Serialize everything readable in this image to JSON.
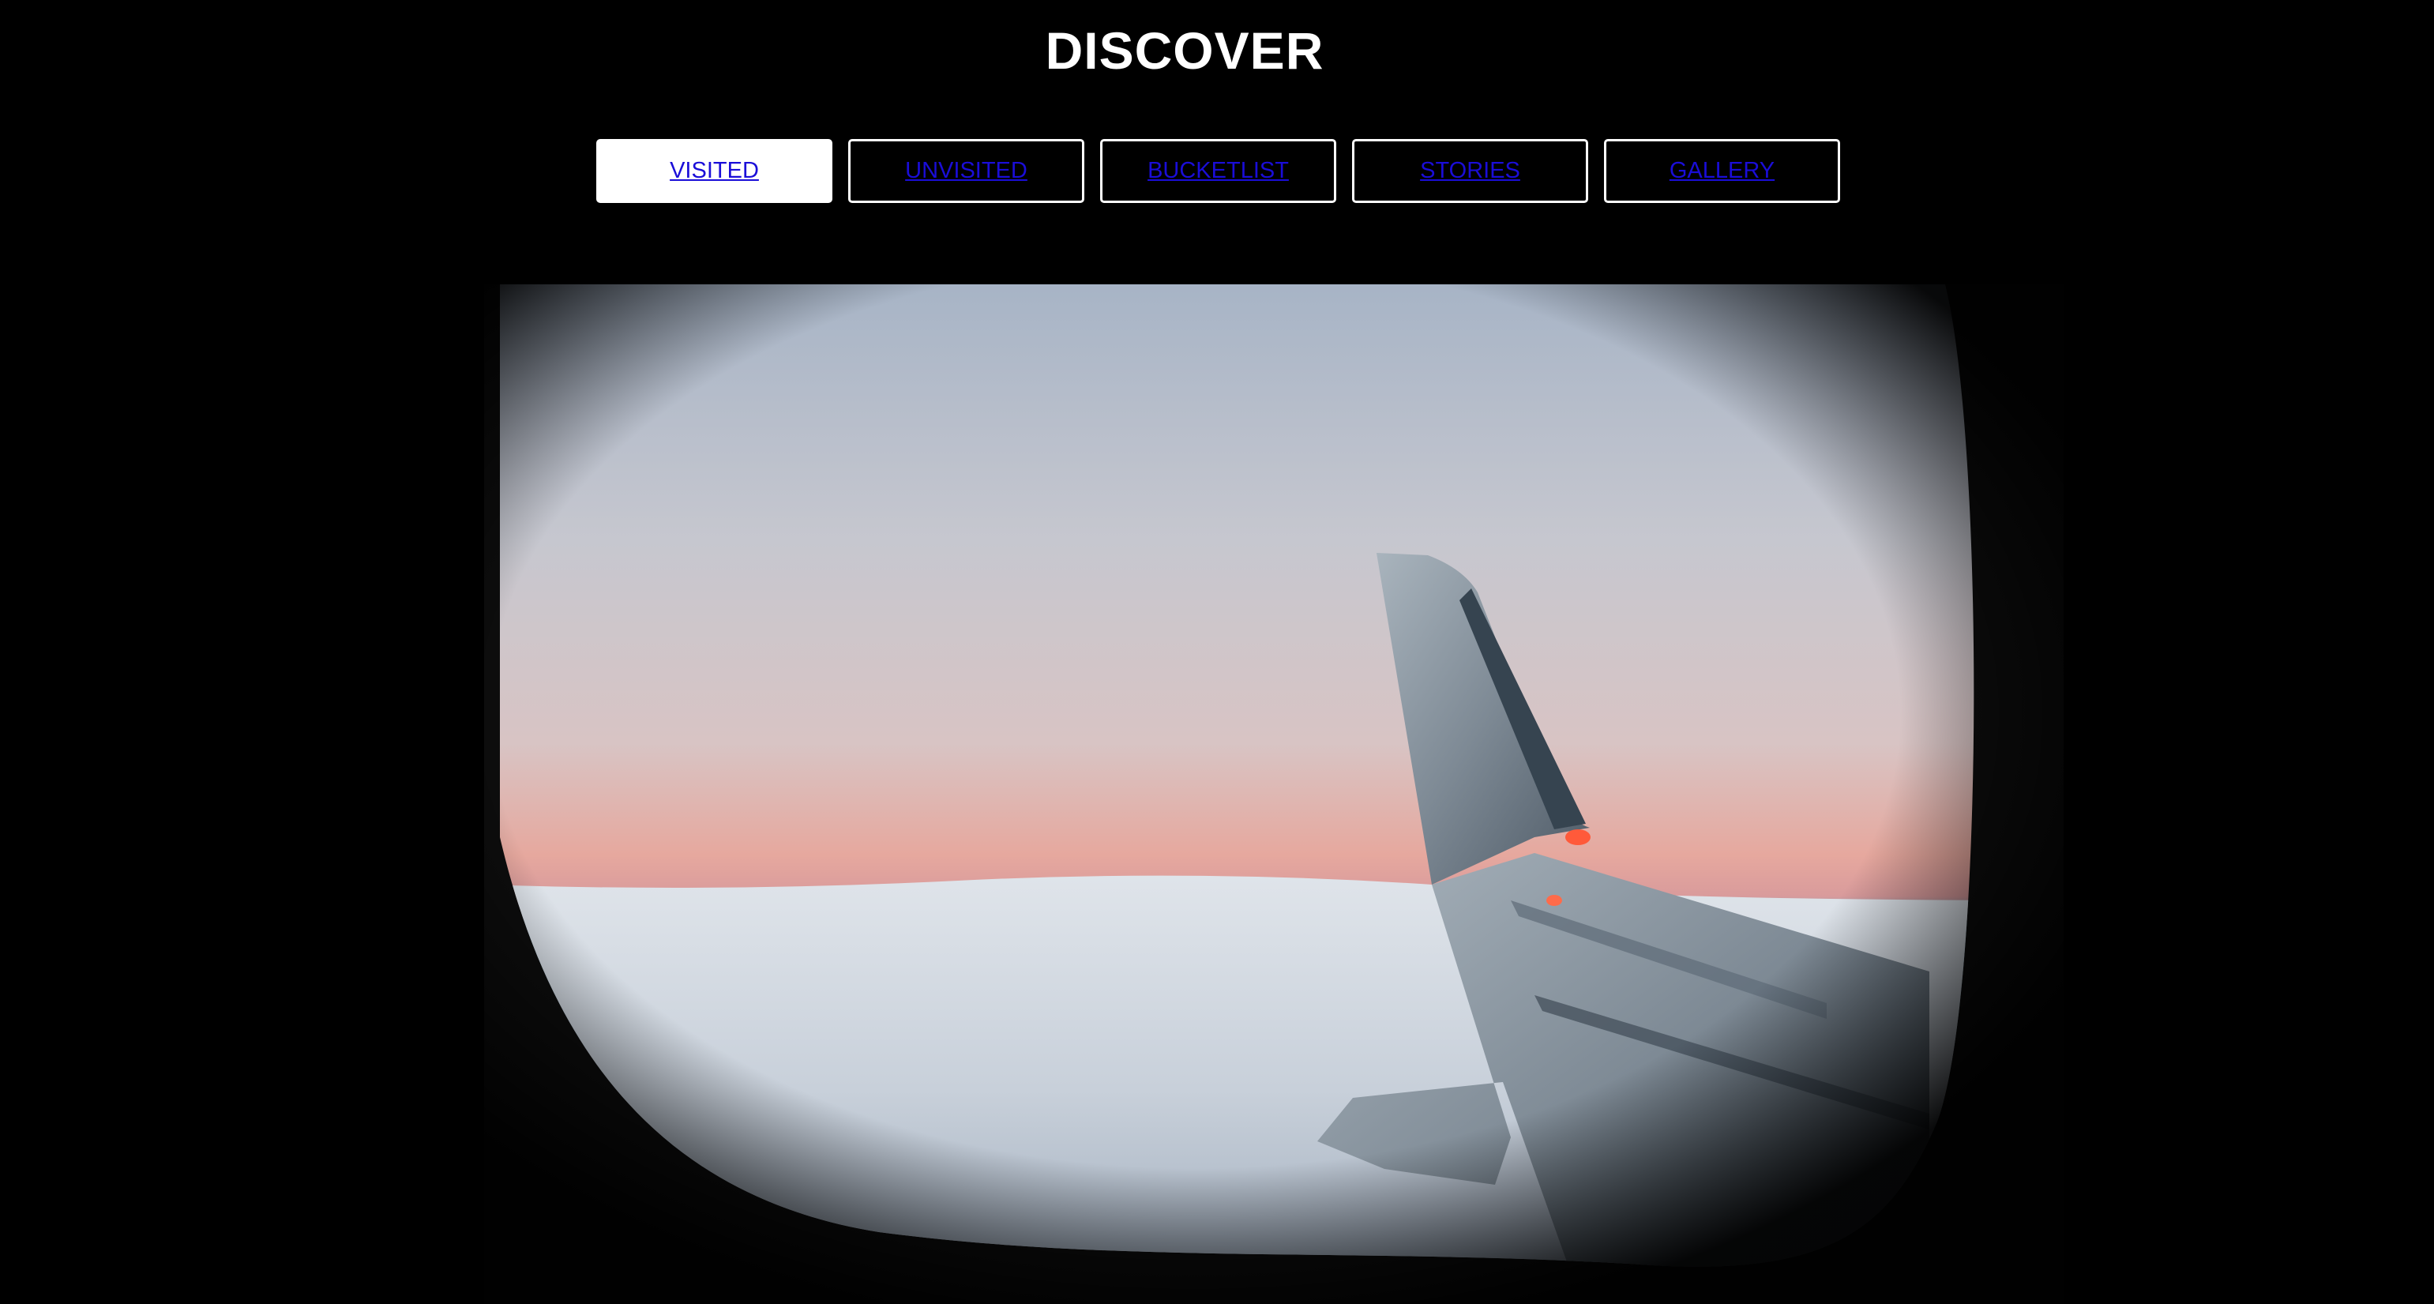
{
  "header": {
    "title": "DISCOVER"
  },
  "nav": {
    "tabs": [
      {
        "label": "VISITED",
        "active": true
      },
      {
        "label": "UNVISITED",
        "active": false
      },
      {
        "label": "BUCKETLIST",
        "active": false
      },
      {
        "label": "STORIES",
        "active": false
      },
      {
        "label": "GALLERY",
        "active": false
      }
    ]
  },
  "photo": {
    "subject": "airplane-window-wing-view"
  },
  "colors": {
    "background": "#000000",
    "link": "#1a0dd8",
    "tab_border": "#ffffff",
    "active_tab_bg": "#ffffff"
  }
}
